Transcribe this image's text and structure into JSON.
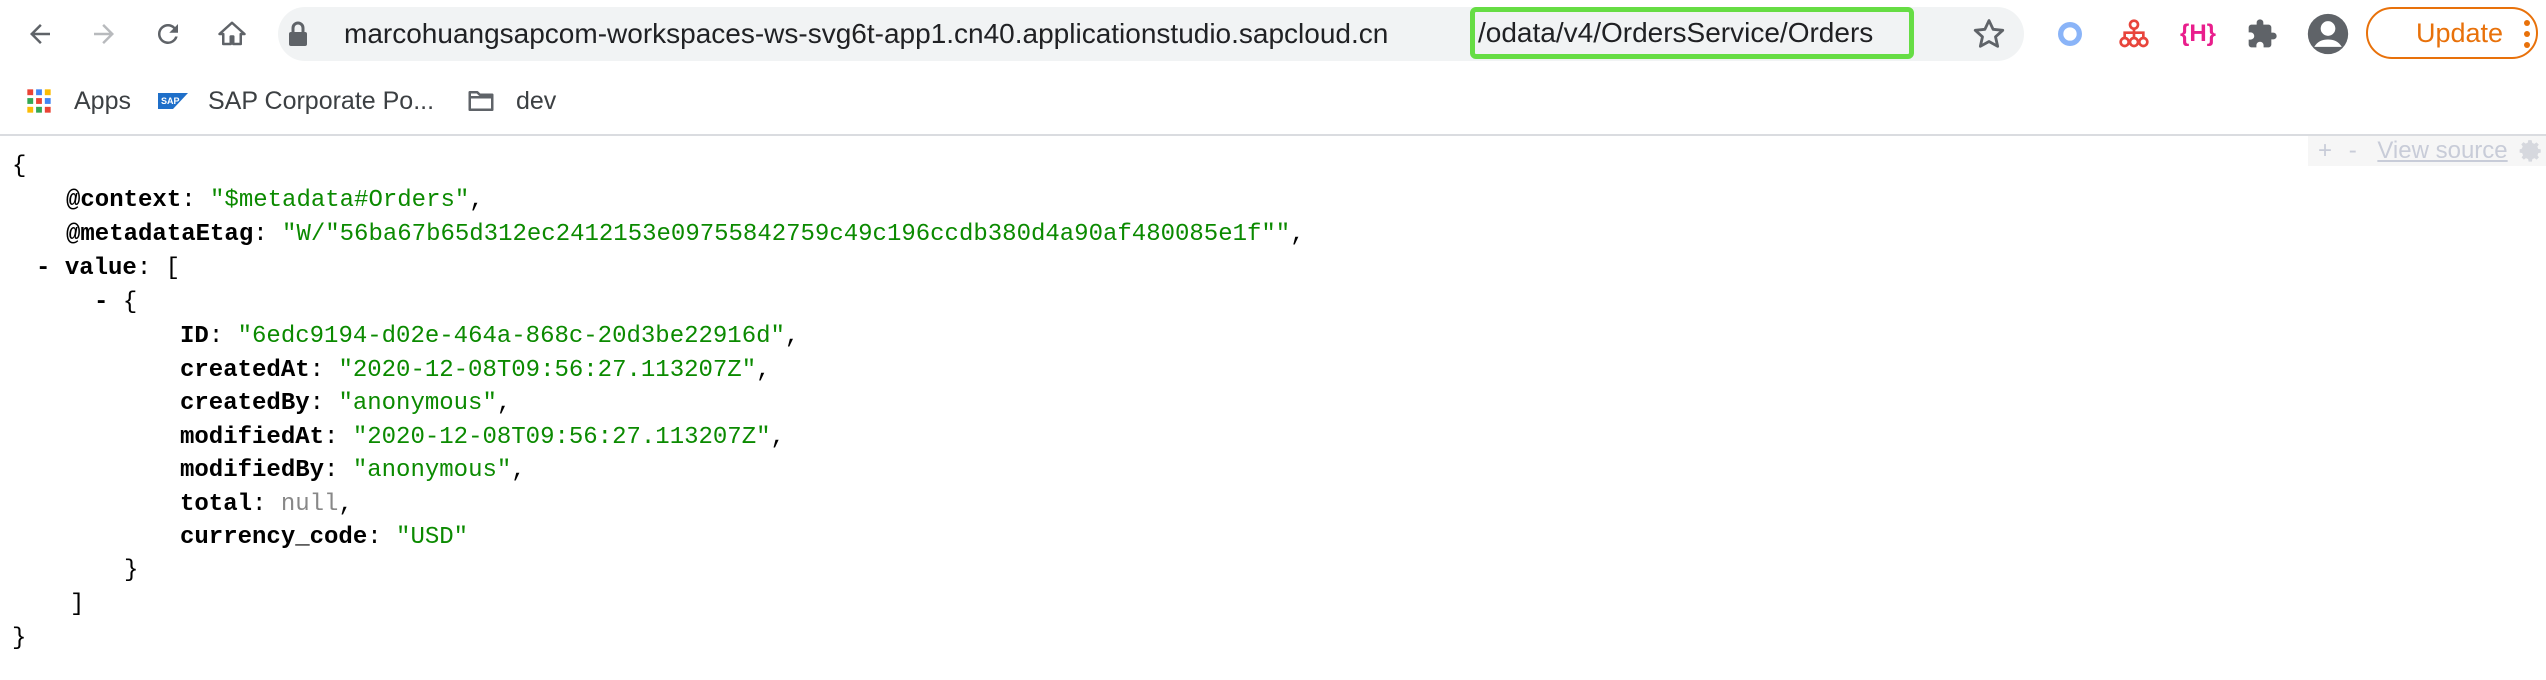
{
  "browser": {
    "url_main": "marcohuangsapcom-workspaces-ws-svg6t-app1.cn40.applicationstudio.sapcloud.cn",
    "url_path": "/odata/v4/OrdersService/Orders",
    "update_label": "Update",
    "extensions": [
      "circle-extension-icon",
      "sitemap-extension-icon",
      "h-extension-icon",
      "puzzle-icon",
      "profile-icon"
    ],
    "h_ext_label": "{H}",
    "update_color": "#e8710a",
    "highlight_color": "#66dd44"
  },
  "bookmarks": [
    {
      "label": "Apps",
      "icon": "apps-grid-icon"
    },
    {
      "label": "SAP Corporate Po...",
      "icon": "sap-logo-icon"
    },
    {
      "label": "dev",
      "icon": "folder-icon"
    }
  ],
  "viewer": {
    "plus": "+",
    "minus": "-",
    "view_source": "View source"
  },
  "json": {
    "open_brace": "{",
    "close_brace": "}",
    "context_key": "@context",
    "context_value": "\"$metadata#Orders\"",
    "etag_key": "@metadataEtag",
    "etag_value": "\"W/\"56ba67b65d312ec2412153e09755842759c49c196ccdb380d4a90af480085e1f\"\"",
    "value_key": "value",
    "open_bracket": "[",
    "close_bracket": "]",
    "collapse_marker": "-",
    "fields": [
      {
        "key": "ID",
        "value": "\"6edc9194-d02e-464a-868c-20d3be22916d\"",
        "type": "string"
      },
      {
        "key": "createdAt",
        "value": "\"2020-12-08T09:56:27.113207Z\"",
        "type": "string"
      },
      {
        "key": "createdBy",
        "value": "\"anonymous\"",
        "type": "string"
      },
      {
        "key": "modifiedAt",
        "value": "\"2020-12-08T09:56:27.113207Z\"",
        "type": "string"
      },
      {
        "key": "modifiedBy",
        "value": "\"anonymous\"",
        "type": "string"
      },
      {
        "key": "total",
        "value": "null",
        "type": "null"
      },
      {
        "key": "currency_code",
        "value": "\"USD\"",
        "type": "string"
      }
    ],
    "string_color": "#0b8a00",
    "null_color": "#888888"
  }
}
